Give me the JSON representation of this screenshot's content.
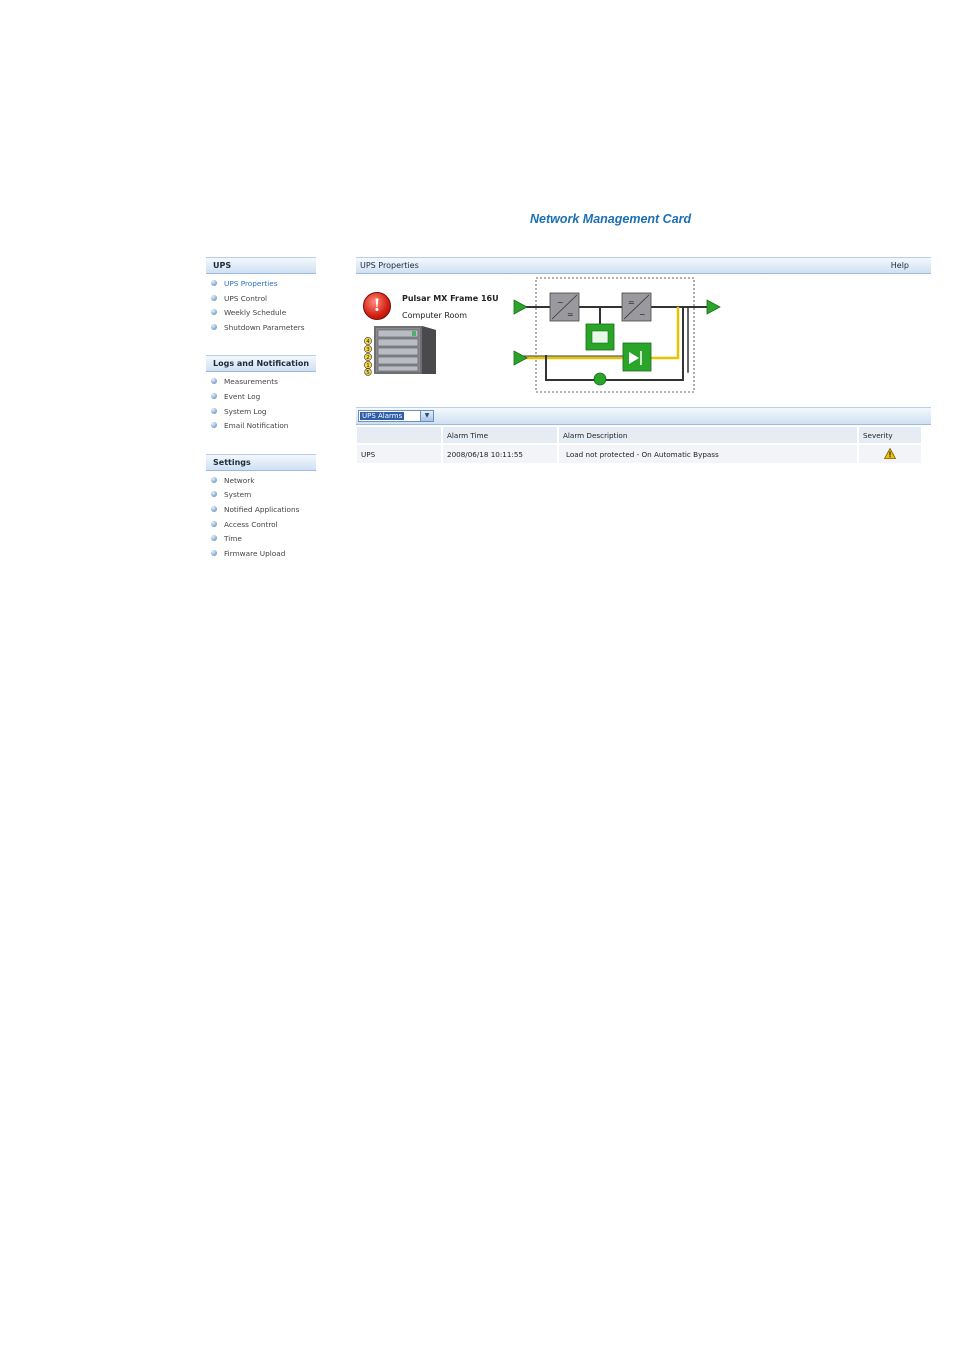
{
  "app_title": "Network Management Card",
  "sidebar": {
    "sections": [
      {
        "title": "UPS",
        "items": [
          "UPS Properties",
          "UPS Control",
          "Weekly Schedule",
          "Shutdown Parameters"
        ],
        "active": "UPS Properties"
      },
      {
        "title": "Logs and Notification",
        "items": [
          "Measurements",
          "Event Log",
          "System Log",
          "Email Notification"
        ]
      },
      {
        "title": "Settings",
        "items": [
          "Network",
          "System",
          "Notified Applications",
          "Access Control",
          "Time",
          "Firmware Upload"
        ]
      }
    ]
  },
  "panel": {
    "title": "UPS Properties",
    "help_label": "Help",
    "ups_name": "Pulsar MX Frame 16U",
    "ups_location": "Computer Room",
    "status_icon": "alarm-exclamation-icon",
    "module_numbers": [
      "4",
      "3",
      "2",
      "1",
      "5"
    ]
  },
  "alarms": {
    "select_value": "UPS Alarms",
    "columns": [
      "",
      "Alarm Time",
      "Alarm Description",
      "Severity"
    ],
    "rows": [
      {
        "source": "UPS",
        "time": "2008/06/18 10:11:55",
        "description": "Load not protected - On Automatic Bypass",
        "severity_icon": "warning-triangle-icon"
      }
    ]
  },
  "colors": {
    "accent": "#1a6fb5",
    "header_gradient": "#cfe0f3",
    "alarm_red": "#d21e12",
    "flow_green": "#2aa52a",
    "flow_yellow": "#e8c400"
  }
}
